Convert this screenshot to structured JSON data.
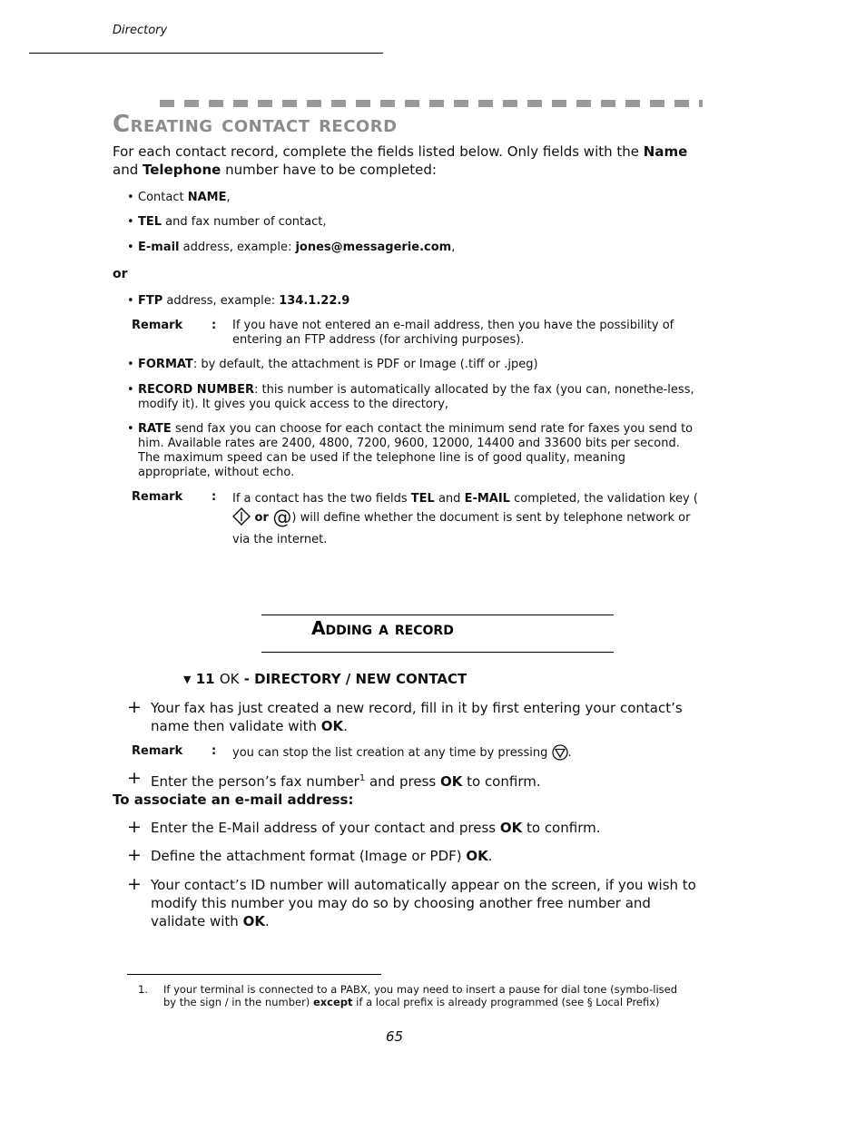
{
  "header": {
    "section": "Directory"
  },
  "section1": {
    "title": "Creating contact record",
    "intro": {
      "a": "For each contact record, complete the fields listed below. Only fields with the ",
      "b1": "Name",
      "c": " and ",
      "b2": "Telephone",
      "d": " number have to be completed:"
    },
    "bullets": [
      {
        "pre": "Contact ",
        "bold": "NAME",
        "post": ","
      },
      {
        "bold": "TEL",
        "post": " and fax number of contact,"
      },
      {
        "bold": "E-mail",
        "mid": " address, example: ",
        "bold2": "jones@messagerie.com",
        "post": ","
      }
    ],
    "or": "or",
    "ftp": {
      "bold": "FTP",
      "mid": " address, example: ",
      "bold2": "134.1.22.9"
    },
    "remark1": {
      "label": "Remark",
      "colon": ":",
      "text": "If you have not entered an e-mail address, then you have the possibility of entering an FTP address (for archiving purposes)."
    },
    "format": {
      "bold": "FORMAT",
      "post": ":  by default, the attachment is PDF or Image (.tiff or .jpeg)"
    },
    "record_number": {
      "bold": "RECORD NUMBER",
      "post": ": this number is automatically allocated by the fax (you can, nonethe-less, modify it). It gives you quick access to the directory,"
    },
    "rate": {
      "bold": "RATE",
      "post": " send fax you can choose for each contact the minimum send rate for faxes you send to him.  Available rates are 2400, 4800, 7200, 9600, 12000, 14400 and 33600 bits per second. The maximum speed can be used if the telephone line is of good quality, meaning appropriate, without echo."
    },
    "remark2": {
      "label": "Remark",
      "colon": ":",
      "a": "If a contact has the two fields ",
      "b1": "TEL",
      "c": " and ",
      "b2": "E-MAIL",
      "d": " completed, the validation key (",
      "or": " or ",
      "e": ") will define whether the document is sent by telephone network or via the internet.",
      "icon1": "start-key-icon",
      "icon2": "at-key-icon"
    }
  },
  "section2": {
    "title": "Adding a record",
    "menu_path": {
      "arrow": "▼",
      "num": "11",
      "ok": "OK",
      "path": " - DIRECTORY / NEW CONTACT"
    },
    "step1": {
      "a": "Your fax has just created a new record, fill in it by first entering your contact’s name then validate with ",
      "ok": "OK",
      "b": "."
    },
    "remark": {
      "label": "Remark",
      "colon": ":",
      "text": "you can stop the list creation at any time by pressing ",
      "icon": "stop-key-icon",
      "end": "."
    },
    "step2": {
      "a": "Enter the person’s fax number",
      "sup": "1",
      "b": " and press ",
      "ok": "OK",
      "c": " to confirm."
    },
    "subhead": "To associate an e-mail address:",
    "step3": {
      "a": "Enter the E-Mail address of your contact and press ",
      "ok": "OK",
      "b": " to confirm."
    },
    "step4": {
      "a": "Define the attachment format (Image or PDF) ",
      "ok": "OK",
      "b": "."
    },
    "step5": {
      "a": "Your contact’s ID number will automatically appear on the screen, if you wish to modify this number you may do so by choosing another free number and validate with ",
      "ok": "OK",
      "b": "."
    },
    "plus": "+"
  },
  "footnote": {
    "num": "1.",
    "a": "If your terminal is connected to a PABX, you may need to insert a pause for dial tone  (symbo-lised by the sign / in the number) ",
    "bold": "except",
    "b": "  if a local prefix is already programmed (see § Local Prefix)"
  },
  "page_number": "65"
}
